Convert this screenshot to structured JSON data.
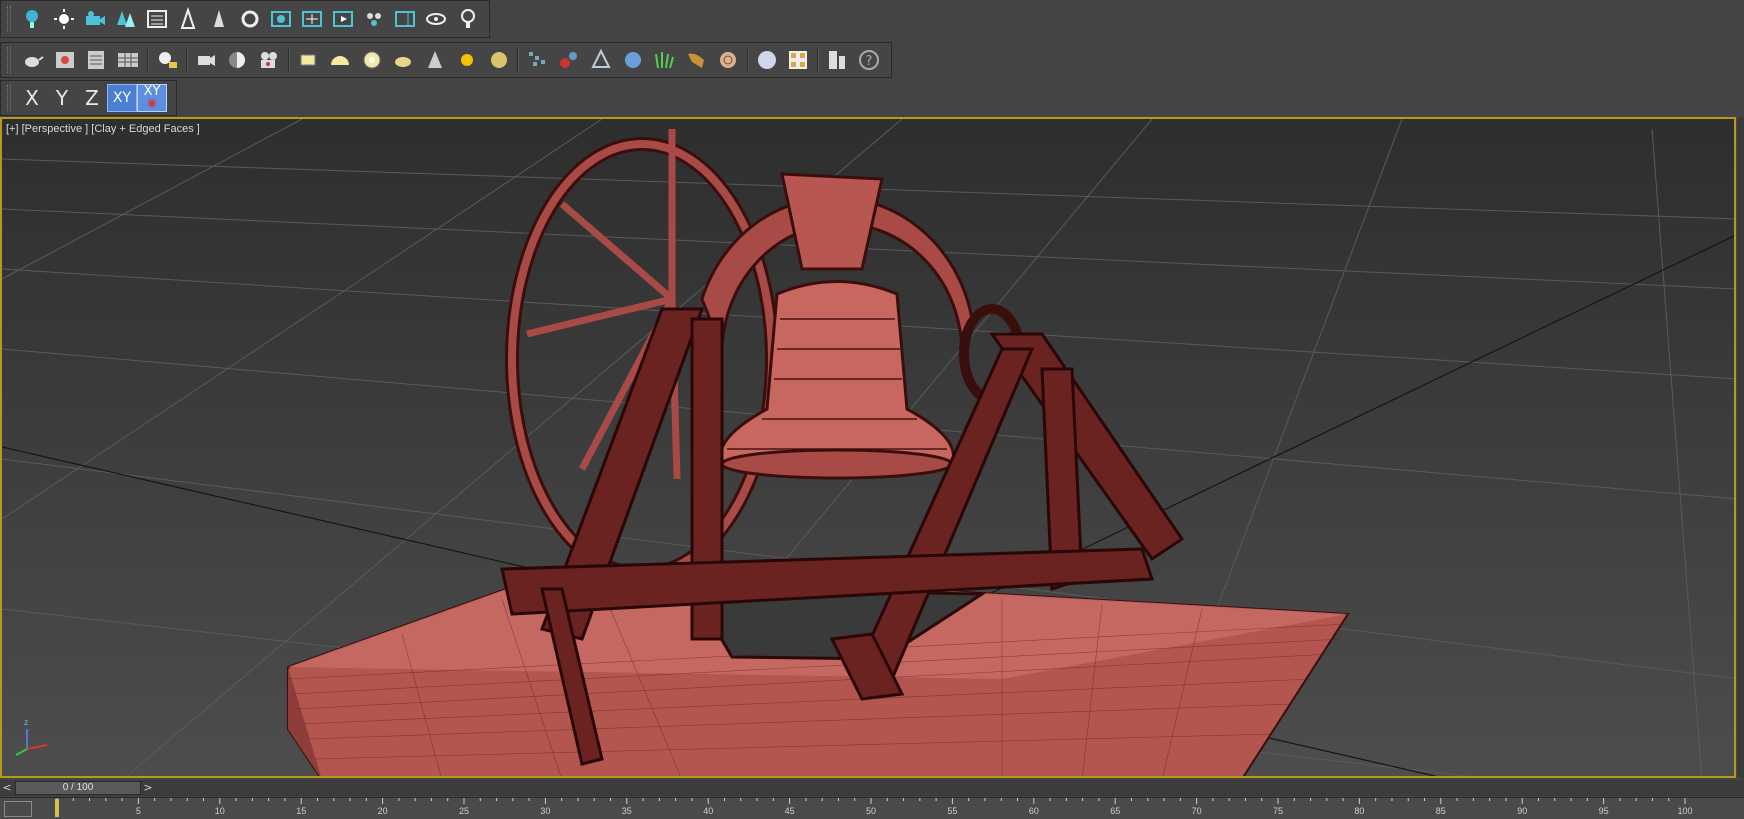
{
  "toolbar_main": {
    "icons": [
      "light-bulb-icon",
      "sun-icon",
      "camera-group-icon",
      "trees-icon",
      "list-icon",
      "spline-tool-icon",
      "tree-shape-icon",
      "refresh-icon",
      "render-frame-icon",
      "crosshair-icon",
      "playback-icon",
      "particle-icon",
      "viewport-icon",
      "eye-icon",
      "bulb-outline-icon"
    ]
  },
  "toolbar_create": {
    "icons": [
      "teapot-icon",
      "render-setup-icon",
      "table-icon",
      "grid-icon",
      "light-list-icon",
      "video-camera-icon",
      "sphere-shade-icon",
      "film-camera-icon",
      "plane-icon",
      "dome-icon",
      "disc-icon",
      "teapot-small-icon",
      "cone-icon",
      "sun-light-icon",
      "sphere-gold-icon",
      "scatter-icon",
      "molecule-icon",
      "pyramid-icon",
      "gear-sphere-icon",
      "grass-icon",
      "hair-fur-icon",
      "spiral-icon",
      "material-sphere-icon",
      "material-editor-icon",
      "panel-icon",
      "help-icon"
    ]
  },
  "axis_toolbar": {
    "x": "X",
    "y": "Y",
    "z": "Z",
    "xy": "XY",
    "xy_lock": "XY"
  },
  "viewport": {
    "label": "[+] [Perspective ] [Clay + Edged Faces ]",
    "model_color": "#c45a55",
    "border_color": "#b79a1d"
  },
  "time_slider": {
    "prev": "<",
    "next": ">",
    "value": "0 / 100"
  },
  "track_ticks": [
    "5",
    "10",
    "15",
    "20",
    "25",
    "30",
    "35",
    "40",
    "45",
    "50",
    "55",
    "60",
    "65",
    "70",
    "75",
    "80",
    "85",
    "90",
    "95",
    "100"
  ]
}
